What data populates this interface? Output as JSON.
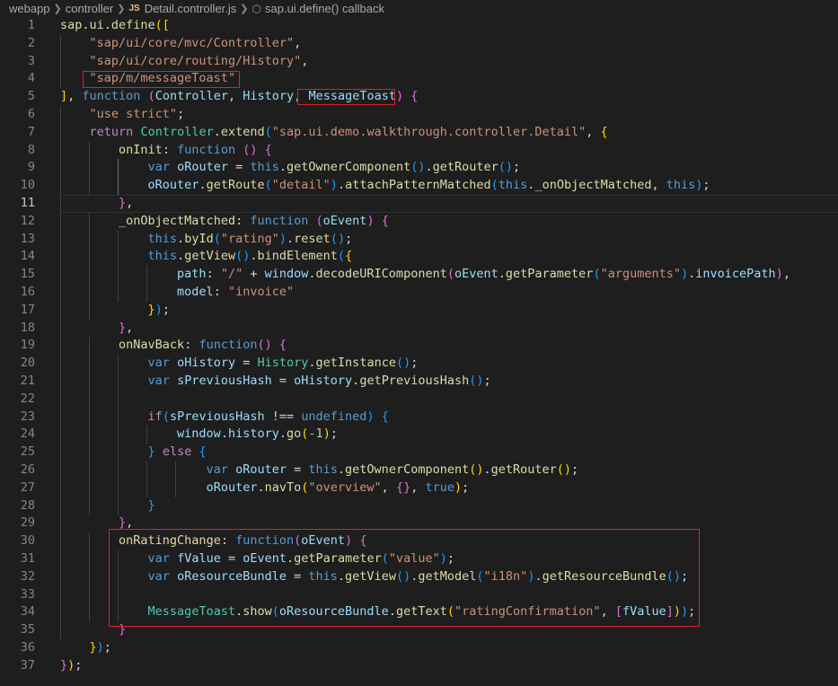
{
  "breadcrumb": {
    "items": [
      "webapp",
      "controller",
      "Detail.controller.js",
      "sap.ui.define() callback"
    ],
    "file_icon": "JS"
  },
  "editor": {
    "active_line": 11,
    "highlight_color": "#e0202a",
    "lines": [
      [
        [
          "sap.ui.define",
          "fn"
        ],
        [
          "([",
          "b1"
        ]
      ],
      [
        [
          "    ",
          "op"
        ],
        [
          "\"sap/ui/core/mvc/Controller\"",
          "str"
        ],
        [
          ",",
          "op"
        ]
      ],
      [
        [
          "    ",
          "op"
        ],
        [
          "\"sap/ui/core/routing/History\"",
          "str"
        ],
        [
          ",",
          "op"
        ]
      ],
      [
        [
          "    ",
          "op"
        ],
        [
          "\"sap/m/messageToast\"",
          "str"
        ]
      ],
      [
        [
          "]",
          "b1"
        ],
        [
          ", ",
          "op"
        ],
        [
          "function",
          "kw"
        ],
        [
          " ",
          "op"
        ],
        [
          "(",
          "b2"
        ],
        [
          "Controller",
          "var"
        ],
        [
          ", ",
          "op"
        ],
        [
          "History",
          "var"
        ],
        [
          ", ",
          "op"
        ],
        [
          "MessageToast",
          "var"
        ],
        [
          ")",
          "b2"
        ],
        [
          " ",
          "op"
        ],
        [
          "{",
          "b2"
        ]
      ],
      [
        [
          "    ",
          "op"
        ],
        [
          "\"use strict\"",
          "str"
        ],
        [
          ";",
          "op"
        ]
      ],
      [
        [
          "    ",
          "op"
        ],
        [
          "return",
          "cf"
        ],
        [
          " ",
          "op"
        ],
        [
          "Controller",
          "cls"
        ],
        [
          ".",
          "op"
        ],
        [
          "extend",
          "fn"
        ],
        [
          "(",
          "b3"
        ],
        [
          "\"sap.ui.demo.walkthrough.controller.Detail\"",
          "str"
        ],
        [
          ", ",
          "op"
        ],
        [
          "{",
          "b1"
        ]
      ],
      [
        [
          "        ",
          "op"
        ],
        [
          "onInit",
          "fn"
        ],
        [
          ": ",
          "op"
        ],
        [
          "function",
          "kw"
        ],
        [
          " ",
          "op"
        ],
        [
          "()",
          "b2"
        ],
        [
          " ",
          "op"
        ],
        [
          "{",
          "b2"
        ]
      ],
      [
        [
          "            ",
          "op"
        ],
        [
          "var",
          "kw"
        ],
        [
          " ",
          "op"
        ],
        [
          "oRouter",
          "var"
        ],
        [
          " = ",
          "op"
        ],
        [
          "this",
          "kw"
        ],
        [
          ".",
          "op"
        ],
        [
          "getOwnerComponent",
          "fn"
        ],
        [
          "()",
          "b3"
        ],
        [
          ".",
          "op"
        ],
        [
          "getRouter",
          "fn"
        ],
        [
          "()",
          "b3"
        ],
        [
          ";",
          "op"
        ]
      ],
      [
        [
          "            ",
          "op"
        ],
        [
          "oRouter",
          "var"
        ],
        [
          ".",
          "op"
        ],
        [
          "getRoute",
          "fn"
        ],
        [
          "(",
          "b3"
        ],
        [
          "\"detail\"",
          "str"
        ],
        [
          ")",
          "b3"
        ],
        [
          ".",
          "op"
        ],
        [
          "attachPatternMatched",
          "fn"
        ],
        [
          "(",
          "b3"
        ],
        [
          "this",
          "kw"
        ],
        [
          ".",
          "op"
        ],
        [
          "_onObjectMatched",
          "fn"
        ],
        [
          ", ",
          "op"
        ],
        [
          "this",
          "kw"
        ],
        [
          ")",
          "b3"
        ],
        [
          ";",
          "op"
        ]
      ],
      [
        [
          "        ",
          "op"
        ],
        [
          "}",
          "b2"
        ],
        [
          ",",
          "op"
        ]
      ],
      [
        [
          "        ",
          "op"
        ],
        [
          "_onObjectMatched",
          "fn"
        ],
        [
          ": ",
          "op"
        ],
        [
          "function",
          "kw"
        ],
        [
          " ",
          "op"
        ],
        [
          "(",
          "b2"
        ],
        [
          "oEvent",
          "var"
        ],
        [
          ")",
          "b2"
        ],
        [
          " ",
          "op"
        ],
        [
          "{",
          "b2"
        ]
      ],
      [
        [
          "            ",
          "op"
        ],
        [
          "this",
          "kw"
        ],
        [
          ".",
          "op"
        ],
        [
          "byId",
          "fn"
        ],
        [
          "(",
          "b3"
        ],
        [
          "\"rating\"",
          "str"
        ],
        [
          ")",
          "b3"
        ],
        [
          ".",
          "op"
        ],
        [
          "reset",
          "fn"
        ],
        [
          "()",
          "b3"
        ],
        [
          ";",
          "op"
        ]
      ],
      [
        [
          "            ",
          "op"
        ],
        [
          "this",
          "kw"
        ],
        [
          ".",
          "op"
        ],
        [
          "getView",
          "fn"
        ],
        [
          "()",
          "b3"
        ],
        [
          ".",
          "op"
        ],
        [
          "bindElement",
          "fn"
        ],
        [
          "(",
          "b3"
        ],
        [
          "{",
          "b1"
        ]
      ],
      [
        [
          "                ",
          "op"
        ],
        [
          "path",
          "var"
        ],
        [
          ": ",
          "op"
        ],
        [
          "\"/\"",
          "str"
        ],
        [
          " + ",
          "op"
        ],
        [
          "window",
          "var"
        ],
        [
          ".",
          "op"
        ],
        [
          "decodeURIComponent",
          "fn"
        ],
        [
          "(",
          "b2"
        ],
        [
          "oEvent",
          "var"
        ],
        [
          ".",
          "op"
        ],
        [
          "getParameter",
          "fn"
        ],
        [
          "(",
          "b3"
        ],
        [
          "\"arguments\"",
          "str"
        ],
        [
          ")",
          "b3"
        ],
        [
          ".",
          "op"
        ],
        [
          "invoicePath",
          "var"
        ],
        [
          ")",
          "b2"
        ],
        [
          ",",
          "op"
        ]
      ],
      [
        [
          "                ",
          "op"
        ],
        [
          "model",
          "var"
        ],
        [
          ": ",
          "op"
        ],
        [
          "\"invoice\"",
          "str"
        ]
      ],
      [
        [
          "            ",
          "op"
        ],
        [
          "}",
          "b1"
        ],
        [
          ")",
          "b3"
        ],
        [
          ";",
          "op"
        ]
      ],
      [
        [
          "        ",
          "op"
        ],
        [
          "}",
          "b2"
        ],
        [
          ",",
          "op"
        ]
      ],
      [
        [
          "        ",
          "op"
        ],
        [
          "onNavBack",
          "fn"
        ],
        [
          ": ",
          "op"
        ],
        [
          "function",
          "kw"
        ],
        [
          "()",
          "b2"
        ],
        [
          " ",
          "op"
        ],
        [
          "{",
          "b2"
        ]
      ],
      [
        [
          "            ",
          "op"
        ],
        [
          "var",
          "kw"
        ],
        [
          " ",
          "op"
        ],
        [
          "oHistory",
          "var"
        ],
        [
          " = ",
          "op"
        ],
        [
          "History",
          "cls"
        ],
        [
          ".",
          "op"
        ],
        [
          "getInstance",
          "fn"
        ],
        [
          "()",
          "b3"
        ],
        [
          ";",
          "op"
        ]
      ],
      [
        [
          "            ",
          "op"
        ],
        [
          "var",
          "kw"
        ],
        [
          " ",
          "op"
        ],
        [
          "sPreviousHash",
          "var"
        ],
        [
          " = ",
          "op"
        ],
        [
          "oHistory",
          "var"
        ],
        [
          ".",
          "op"
        ],
        [
          "getPreviousHash",
          "fn"
        ],
        [
          "()",
          "b3"
        ],
        [
          ";",
          "op"
        ]
      ],
      [],
      [
        [
          "            ",
          "op"
        ],
        [
          "if",
          "cf"
        ],
        [
          "(",
          "b3"
        ],
        [
          "sPreviousHash",
          "var"
        ],
        [
          " !== ",
          "op"
        ],
        [
          "undefined",
          "kw"
        ],
        [
          ")",
          "b3"
        ],
        [
          " ",
          "op"
        ],
        [
          "{",
          "b3"
        ]
      ],
      [
        [
          "                ",
          "op"
        ],
        [
          "window",
          "var"
        ],
        [
          ".",
          "op"
        ],
        [
          "history",
          "var"
        ],
        [
          ".",
          "op"
        ],
        [
          "go",
          "fn"
        ],
        [
          "(",
          "b1"
        ],
        [
          "-1",
          "num"
        ],
        [
          ")",
          "b1"
        ],
        [
          ";",
          "op"
        ]
      ],
      [
        [
          "            ",
          "op"
        ],
        [
          "}",
          "b3"
        ],
        [
          " ",
          "op"
        ],
        [
          "else",
          "cf"
        ],
        [
          " ",
          "op"
        ],
        [
          "{",
          "b3"
        ]
      ],
      [
        [
          "                    ",
          "op"
        ],
        [
          "var",
          "kw"
        ],
        [
          " ",
          "op"
        ],
        [
          "oRouter",
          "var"
        ],
        [
          " = ",
          "op"
        ],
        [
          "this",
          "kw"
        ],
        [
          ".",
          "op"
        ],
        [
          "getOwnerComponent",
          "fn"
        ],
        [
          "()",
          "b1"
        ],
        [
          ".",
          "op"
        ],
        [
          "getRouter",
          "fn"
        ],
        [
          "()",
          "b1"
        ],
        [
          ";",
          "op"
        ]
      ],
      [
        [
          "                    ",
          "op"
        ],
        [
          "oRouter",
          "var"
        ],
        [
          ".",
          "op"
        ],
        [
          "navTo",
          "fn"
        ],
        [
          "(",
          "b1"
        ],
        [
          "\"overview\"",
          "str"
        ],
        [
          ", ",
          "op"
        ],
        [
          "{}",
          "b2"
        ],
        [
          ", ",
          "op"
        ],
        [
          "true",
          "kw"
        ],
        [
          ")",
          "b1"
        ],
        [
          ";",
          "op"
        ]
      ],
      [
        [
          "            ",
          "op"
        ],
        [
          "}",
          "b3"
        ]
      ],
      [
        [
          "        ",
          "op"
        ],
        [
          "}",
          "b2"
        ],
        [
          ",",
          "op"
        ]
      ],
      [
        [
          "        ",
          "op"
        ],
        [
          "onRatingChange",
          "fn"
        ],
        [
          ": ",
          "op"
        ],
        [
          "function",
          "kw"
        ],
        [
          "(",
          "b2"
        ],
        [
          "oEvent",
          "var"
        ],
        [
          ")",
          "b2"
        ],
        [
          " ",
          "op"
        ],
        [
          "{",
          "b2"
        ]
      ],
      [
        [
          "            ",
          "op"
        ],
        [
          "var",
          "kw"
        ],
        [
          " ",
          "op"
        ],
        [
          "fValue",
          "var"
        ],
        [
          " = ",
          "op"
        ],
        [
          "oEvent",
          "var"
        ],
        [
          ".",
          "op"
        ],
        [
          "getParameter",
          "fn"
        ],
        [
          "(",
          "b3"
        ],
        [
          "\"value\"",
          "str"
        ],
        [
          ")",
          "b3"
        ],
        [
          ";",
          "op"
        ]
      ],
      [
        [
          "            ",
          "op"
        ],
        [
          "var",
          "kw"
        ],
        [
          " ",
          "op"
        ],
        [
          "oResourceBundle",
          "var"
        ],
        [
          " = ",
          "op"
        ],
        [
          "this",
          "kw"
        ],
        [
          ".",
          "op"
        ],
        [
          "getView",
          "fn"
        ],
        [
          "()",
          "b3"
        ],
        [
          ".",
          "op"
        ],
        [
          "getModel",
          "fn"
        ],
        [
          "(",
          "b3"
        ],
        [
          "\"i18n\"",
          "str"
        ],
        [
          ")",
          "b3"
        ],
        [
          ".",
          "op"
        ],
        [
          "getResourceBundle",
          "fn"
        ],
        [
          "()",
          "b3"
        ],
        [
          ";",
          "op"
        ]
      ],
      [],
      [
        [
          "            ",
          "op"
        ],
        [
          "MessageToast",
          "cls"
        ],
        [
          ".",
          "op"
        ],
        [
          "show",
          "fn"
        ],
        [
          "(",
          "b3"
        ],
        [
          "oResourceBundle",
          "var"
        ],
        [
          ".",
          "op"
        ],
        [
          "getText",
          "fn"
        ],
        [
          "(",
          "b1"
        ],
        [
          "\"ratingConfirmation\"",
          "str"
        ],
        [
          ", ",
          "op"
        ],
        [
          "[",
          "b2"
        ],
        [
          "fValue",
          "var"
        ],
        [
          "]",
          "b2"
        ],
        [
          ")",
          "b1"
        ],
        [
          ")",
          "b3"
        ],
        [
          ";",
          "op"
        ]
      ],
      [
        [
          "        ",
          "op"
        ],
        [
          "}",
          "b2"
        ]
      ],
      [
        [
          "    ",
          "op"
        ],
        [
          "}",
          "b1"
        ],
        [
          ")",
          "b3"
        ],
        [
          ";",
          "op"
        ]
      ],
      [
        [
          "}",
          "b2"
        ],
        [
          ")",
          "b1"
        ],
        [
          ";",
          "op"
        ]
      ]
    ]
  }
}
